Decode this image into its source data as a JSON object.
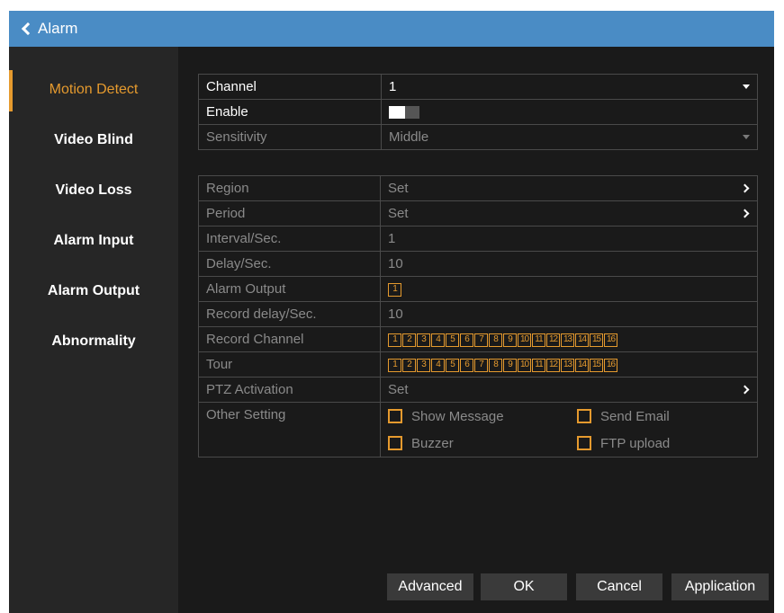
{
  "title": "Alarm",
  "sidebar": {
    "items": [
      {
        "label": "Motion Detect"
      },
      {
        "label": "Video Blind"
      },
      {
        "label": "Video Loss"
      },
      {
        "label": "Alarm Input"
      },
      {
        "label": "Alarm Output"
      },
      {
        "label": "Abnormality"
      }
    ],
    "active": "Motion Detect"
  },
  "form": {
    "channel_label": "Channel",
    "channel_value": "1",
    "enable_label": "Enable",
    "enable_state": "on",
    "sensitivity_label": "Sensitivity",
    "sensitivity_value": "Middle",
    "region_label": "Region",
    "region_value": "Set",
    "period_label": "Period",
    "period_value": "Set",
    "interval_label": "Interval/Sec.",
    "interval_value": "1",
    "delay_label": "Delay/Sec.",
    "delay_value": "10",
    "alarm_output_label": "Alarm Output",
    "alarm_output_channels": [
      "1"
    ],
    "record_delay_label": "Record delay/Sec.",
    "record_delay_value": "10",
    "record_channel_label": "Record Channel",
    "record_channels": [
      "1",
      "2",
      "3",
      "4",
      "5",
      "6",
      "7",
      "8",
      "9",
      "10",
      "11",
      "12",
      "13",
      "14",
      "15",
      "16"
    ],
    "tour_label": "Tour",
    "tour_channels": [
      "1",
      "2",
      "3",
      "4",
      "5",
      "6",
      "7",
      "8",
      "9",
      "10",
      "11",
      "12",
      "13",
      "14",
      "15",
      "16"
    ],
    "ptz_label": "PTZ Activation",
    "ptz_value": "Set",
    "other_label": "Other Setting",
    "other_options": {
      "show_message": "Show Message",
      "send_email": "Send Email",
      "buzzer": "Buzzer",
      "ftp_upload": "FTP upload"
    }
  },
  "buttons": {
    "advanced": "Advanced",
    "ok": "OK",
    "cancel": "Cancel",
    "application": "Application"
  },
  "colors": {
    "accent": "#e59a2e",
    "titlebar": "#4a8cc5",
    "background": "#1a1a1a"
  }
}
